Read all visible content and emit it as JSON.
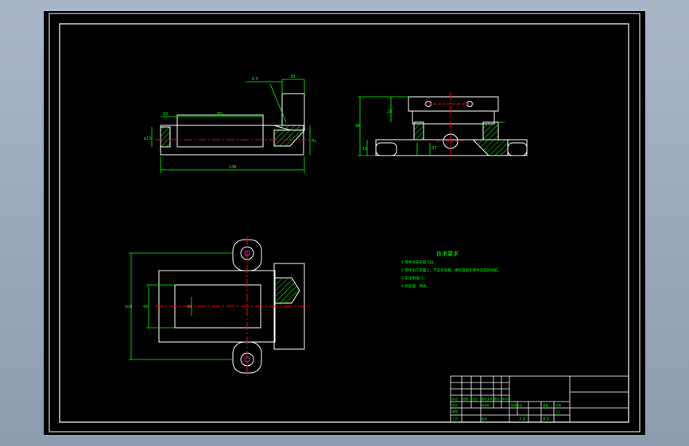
{
  "colors": {
    "background": "#000000",
    "window": "#9aa8bb",
    "outline": "#ffffff",
    "dimension": "#00ff00",
    "centerline": "#ff0000",
    "hatch": "#00ff00",
    "hole_accent": "#ff00ff"
  },
  "views": {
    "front": {
      "dims": {
        "top_small": "0.5",
        "top_right": "30",
        "left_small": "22",
        "length_inner": "95",
        "height_left": "φ15",
        "height_right": "Rc",
        "overall_length": "148"
      }
    },
    "side": {
      "dims": {
        "left_total": "96",
        "left_upper": "28",
        "left_lower": "16",
        "center_small": "R7"
      }
    },
    "top": {
      "dims": {
        "left_overall": "100",
        "inner_left": "42",
        "inner_center": "20"
      }
    }
  },
  "notes": {
    "title": "技术要求",
    "lines": [
      "1.零件须去毛刺飞边。",
      "2.零件加工表面上，不应有划痕、擦伤等损伤零件表面的缺陷。",
      "3.未注倒角C1。",
      "4.热处理：调质。"
    ]
  },
  "title_block": {
    "cells": [
      "标记",
      "处数",
      "分区",
      "更改文件号",
      "签名",
      "年月日",
      "设计",
      "标准化",
      "阶段标记",
      "重量",
      "比例",
      "审核",
      "工艺",
      "批准",
      "共 张",
      "第 张",
      "1:1"
    ]
  }
}
